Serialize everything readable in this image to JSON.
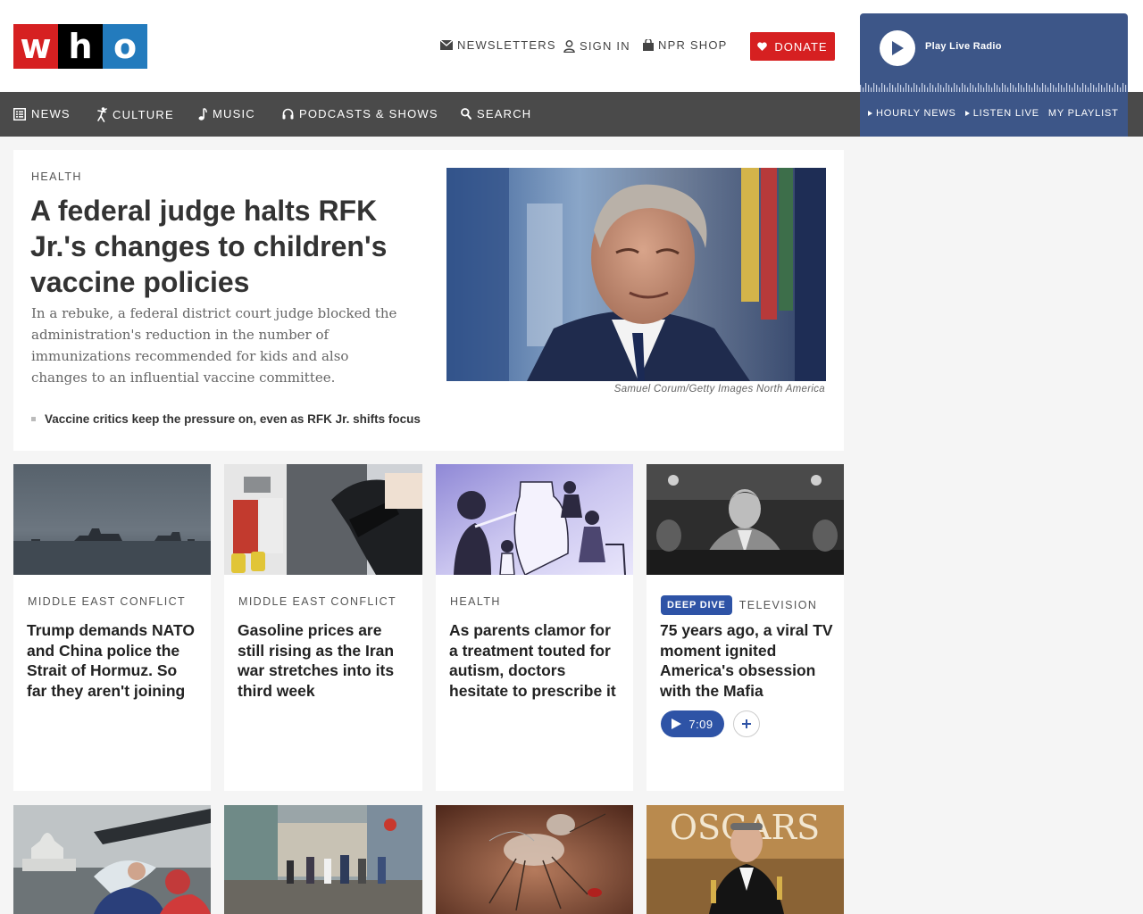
{
  "brand": {
    "logo_letters": [
      "w",
      "h",
      "o"
    ],
    "logo_colors": [
      "#d62021",
      "#000000",
      "#237bbd"
    ]
  },
  "header": {
    "newsletters": "NEWSLETTERS",
    "sign_in": "SIGN IN",
    "shop": "NPR SHOP",
    "donate": "DONATE",
    "accent": "#d62021"
  },
  "nav": {
    "items": [
      {
        "label": "NEWS",
        "icon": "news-icon"
      },
      {
        "label": "CULTURE",
        "icon": "culture-icon"
      },
      {
        "label": "MUSIC",
        "icon": "music-note-icon"
      },
      {
        "label": "PODCASTS & SHOWS",
        "icon": "headphones-icon"
      },
      {
        "label": "SEARCH",
        "icon": "search-icon"
      }
    ]
  },
  "player": {
    "title": "Play Live Radio",
    "links": [
      "HOURLY NEWS",
      "LISTEN LIVE",
      "MY PLAYLIST"
    ],
    "color": "#3d5688"
  },
  "lead": {
    "eyebrow": "HEALTH",
    "title": "A federal judge halts RFK Jr.'s changes to children's vaccine policies",
    "teaser": "In a rebuke, a federal district court judge blocked the administration's reduction in the number of immunizations recommended for kids and also changes to an influential vaccine committee.",
    "related": "Vaccine critics keep the pressure on, even as RFK Jr. shifts focus",
    "credit": "Samuel Corum/Getty Images North America"
  },
  "cards": [
    {
      "eyebrow": "MIDDLE EAST CONFLICT",
      "title": "Trump demands NATO and China police the Strait of Hormuz. So far they aren't joining"
    },
    {
      "eyebrow": "MIDDLE EAST CONFLICT",
      "title": "Gasoline prices are still rising as the Iran war stretches into its third week"
    },
    {
      "eyebrow": "HEALTH",
      "title": "As parents clamor for a treatment touted for autism, doctors hesitate to prescribe it"
    },
    {
      "badge": "DEEP DIVE",
      "eyebrow": "TELEVISION",
      "title": "75 years ago, a viral TV moment ignited America's obsession with the Mafia",
      "audio_duration": "7:09"
    }
  ],
  "row2_images": [
    "capitol-rain-photo",
    "havana-street-photo",
    "mosquito-skin-photo",
    "oscars-winner-photo"
  ],
  "row2_text": {
    "oscars_sign": "OSCARS"
  }
}
